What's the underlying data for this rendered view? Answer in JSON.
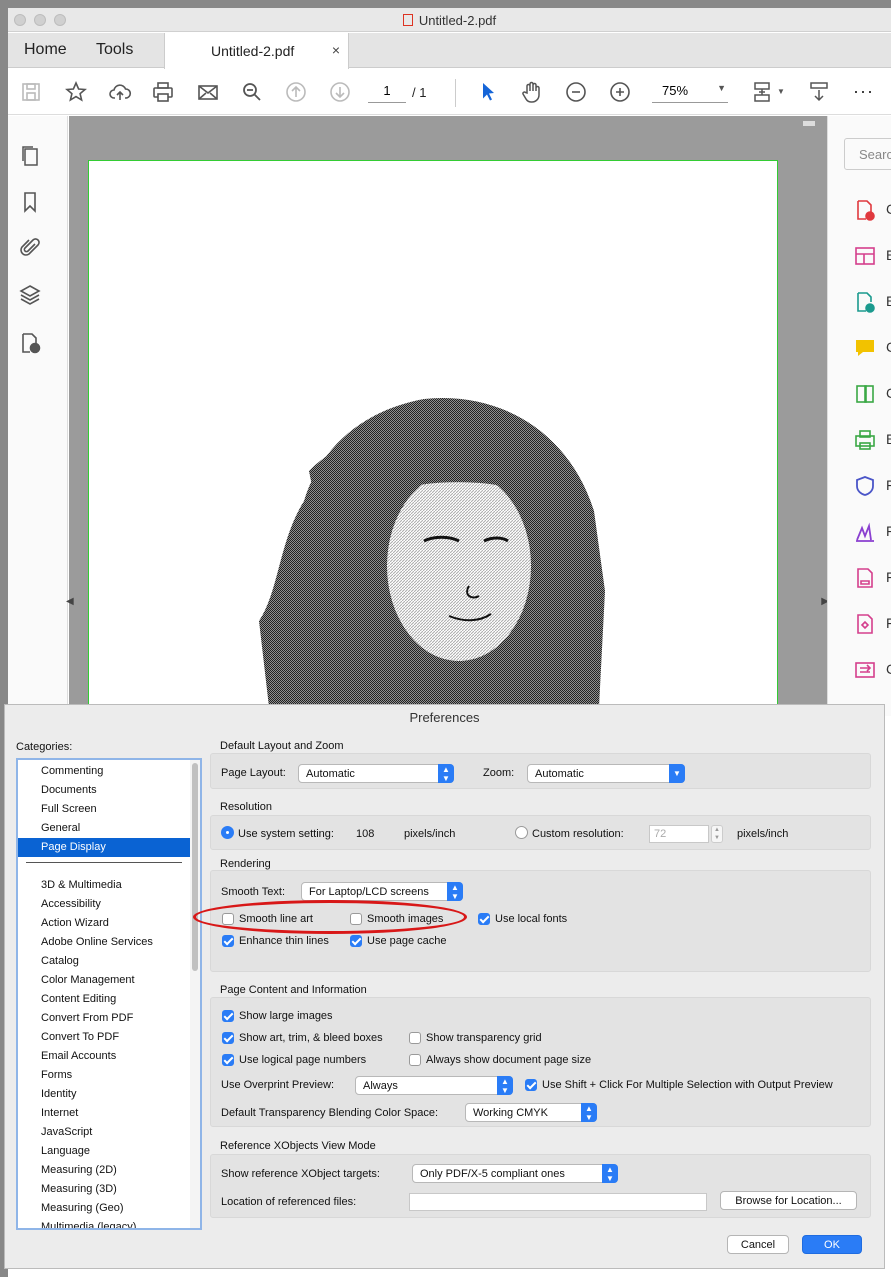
{
  "window": {
    "title": "Untitled-2.pdf"
  },
  "tabs": {
    "home": "Home",
    "tools": "Tools",
    "document": "Untitled-2.pdf",
    "close": "×"
  },
  "toolbar": {
    "page_current": "1",
    "page_total": "/ 1",
    "zoom": "75%",
    "more": "···"
  },
  "right_panel": {
    "search_placeholder": "Searc",
    "tool_letters": [
      "C",
      "E",
      "E",
      "C",
      "C",
      "E",
      "F",
      "F",
      "F",
      "F",
      "C"
    ]
  },
  "colors": {
    "accent": "#2a7cf6",
    "selection": "#0a63d3",
    "annotation_ring": "#d81818",
    "page_border": "#33cc33"
  },
  "dialog": {
    "title": "Preferences",
    "categories_label": "Categories:",
    "categories_top": [
      "Commenting",
      "Documents",
      "Full Screen",
      "General",
      "Page Display"
    ],
    "categories_rest": [
      "3D & Multimedia",
      "Accessibility",
      "Action Wizard",
      "Adobe Online Services",
      "Catalog",
      "Color Management",
      "Content Editing",
      "Convert From PDF",
      "Convert To PDF",
      "Email Accounts",
      "Forms",
      "Identity",
      "Internet",
      "JavaScript",
      "Language",
      "Measuring (2D)",
      "Measuring (3D)",
      "Measuring (Geo)",
      "Multimedia (legacy)"
    ],
    "selected_category": "Page Display",
    "layout": {
      "title": "Default Layout and Zoom",
      "page_layout_label": "Page Layout:",
      "page_layout": "Automatic",
      "zoom_label": "Zoom:",
      "zoom": "Automatic"
    },
    "resolution": {
      "title": "Resolution",
      "system_label": "Use system setting:",
      "system_value": "108",
      "units": "pixels/inch",
      "custom_label": "Custom resolution:",
      "custom_value": "72",
      "custom_units": "pixels/inch"
    },
    "rendering": {
      "title": "Rendering",
      "smooth_text_label": "Smooth Text:",
      "smooth_text": "For Laptop/LCD screens",
      "smooth_line_art": "Smooth line art",
      "smooth_images": "Smooth images",
      "local_fonts": "Use local fonts",
      "thin_lines": "Enhance thin lines",
      "page_cache": "Use page cache"
    },
    "content": {
      "title": "Page Content and Information",
      "large_images": "Show large images",
      "art_trim": "Show art, trim, & bleed boxes",
      "transparency_grid": "Show transparency grid",
      "logical_numbers": "Use logical page numbers",
      "doc_page_size": "Always show document page size",
      "overprint_label": "Use Overprint Preview:",
      "overprint": "Always",
      "shift_click": "Use Shift + Click For Multiple Selection with Output Preview",
      "blend_label": "Default Transparency Blending Color Space:",
      "blend": "Working CMYK"
    },
    "xobjects": {
      "title": "Reference XObjects View Mode",
      "targets_label": "Show reference XObject targets:",
      "targets": "Only PDF/X-5 compliant ones",
      "location_label": "Location of referenced files:",
      "browse": "Browse for Location..."
    },
    "cancel": "Cancel",
    "ok": "OK"
  }
}
